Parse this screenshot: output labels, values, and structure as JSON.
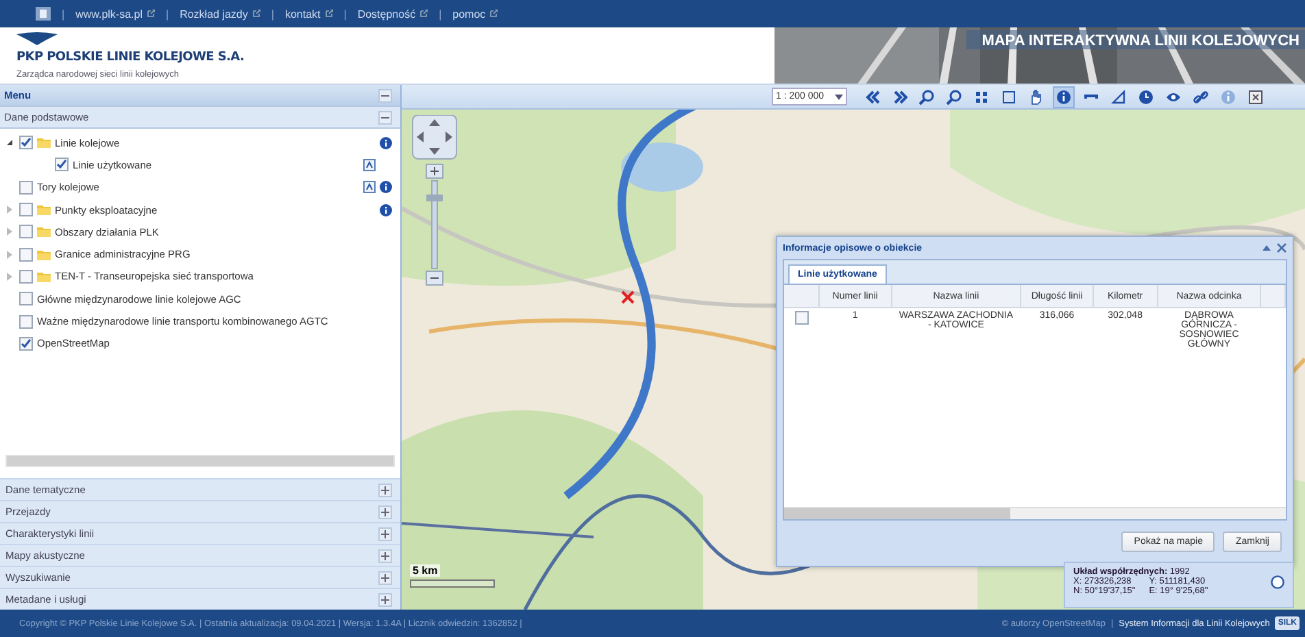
{
  "link_separator": "|",
  "top_links": [
    {
      "label": "www.plk-sa.pl"
    },
    {
      "label": "Rozkład jazdy"
    },
    {
      "label": "kontakt"
    },
    {
      "label": "Dostępność"
    },
    {
      "label": "pomoc"
    }
  ],
  "logo": {
    "name": "PKP POLSKIE LINIE KOLEJOWE S.A.",
    "tagline": "Zarządca narodowej sieci linii kolejowych"
  },
  "banner_title": "MAPA INTERAKTYWNA LINII KOLEJOWYCH",
  "menu": {
    "title": "Menu",
    "panel_title": "Dane podstawowe",
    "layers": [
      {
        "label": "Linie kolejowe",
        "kind": "folder",
        "checked": true,
        "expanded": true,
        "has_info": true,
        "has_legend": false,
        "children": [
          {
            "label": "Linie użytkowane",
            "kind": "layer",
            "checked": true,
            "has_info": false,
            "has_legend": true
          }
        ]
      },
      {
        "label": "Tory kolejowe",
        "kind": "layer",
        "checked": false,
        "has_info": true,
        "has_legend": true
      },
      {
        "label": "Punkty eksploatacyjne",
        "kind": "folder",
        "checked": false,
        "expanded": false,
        "has_info": true,
        "has_legend": false
      },
      {
        "label": "Obszary działania PLK",
        "kind": "folder",
        "checked": false,
        "expanded": false,
        "has_info": false,
        "has_legend": false
      },
      {
        "label": "Granice administracyjne PRG",
        "kind": "folder",
        "checked": false,
        "expanded": false,
        "has_info": false,
        "has_legend": false
      },
      {
        "label": "TEN-T - Transeuropejska sieć transportowa",
        "kind": "folder",
        "checked": false,
        "expanded": false,
        "has_info": false,
        "has_legend": false
      },
      {
        "label": "Główne międzynarodowe linie kolejowe AGC",
        "kind": "layer",
        "checked": false,
        "has_info": false,
        "has_legend": false
      },
      {
        "label": "Ważne międzynarodowe linie transportu kombinowanego AGTC",
        "kind": "layer",
        "checked": false,
        "has_info": false,
        "has_legend": false
      },
      {
        "label": "OpenStreetMap",
        "kind": "layer",
        "checked": true,
        "has_info": false,
        "has_legend": false
      }
    ],
    "sections": [
      {
        "label": "Dane tematyczne"
      },
      {
        "label": "Przejazdy"
      },
      {
        "label": "Charakterystyki linii"
      },
      {
        "label": "Mapy akustyczne"
      },
      {
        "label": "Wyszukiwanie"
      },
      {
        "label": "Metadane i usługi"
      }
    ]
  },
  "toolbar": {
    "scale": "1 : 200 000",
    "tools": [
      {
        "selected": false
      },
      {
        "selected": false
      },
      {
        "selected": false
      },
      {
        "selected": false
      },
      {
        "selected": false
      },
      {
        "selected": false
      },
      {
        "selected": false
      },
      {
        "selected": true
      },
      {
        "selected": false
      },
      {
        "selected": false
      },
      {
        "selected": false
      },
      {
        "selected": false
      },
      {
        "selected": false
      },
      {
        "selected": false
      },
      {
        "selected": false
      }
    ]
  },
  "map": {
    "scale_label": "5 km"
  },
  "dialog": {
    "title": "Informacje opisowe o obiekcie",
    "tabs": [
      {
        "label": "Linie użytkowane",
        "selected": true
      }
    ],
    "columns": [
      "Numer linii",
      "Nazwa linii",
      "Długość linii",
      "Kilometr",
      "Nazwa odcinka"
    ],
    "rows": [
      {
        "checked": false,
        "cells": [
          "1",
          "WARSZAWA ZACHODNIA - KATOWICE",
          "316,066",
          "302,048",
          "DĄBROWA GÓRNICZA - SOSNOWIEC GŁÓWNY"
        ]
      }
    ],
    "buttons": [
      "Pokaż na mapie",
      "Zamknij"
    ]
  },
  "coordinates": {
    "label": "Układ współrzędnych:",
    "system": "1992",
    "x": "X: 273326,238",
    "y": "Y: 511181,430",
    "n": "N: 50°19'37,15\"",
    "e": "E: 19° 9'25,68\""
  },
  "footer": {
    "left": "Copyright © PKP Polskie Linie Kolejowe S.A. | Ostatnia aktualizacja: 09.04.2021 | Wersja: 1.3.4A | Licznik odwiedzin: 1362852 |",
    "osm": "© autorzy OpenStreetMap",
    "separator": "|",
    "system": "System Informacji dla Linii Kolejowych",
    "badge": "SILK"
  }
}
